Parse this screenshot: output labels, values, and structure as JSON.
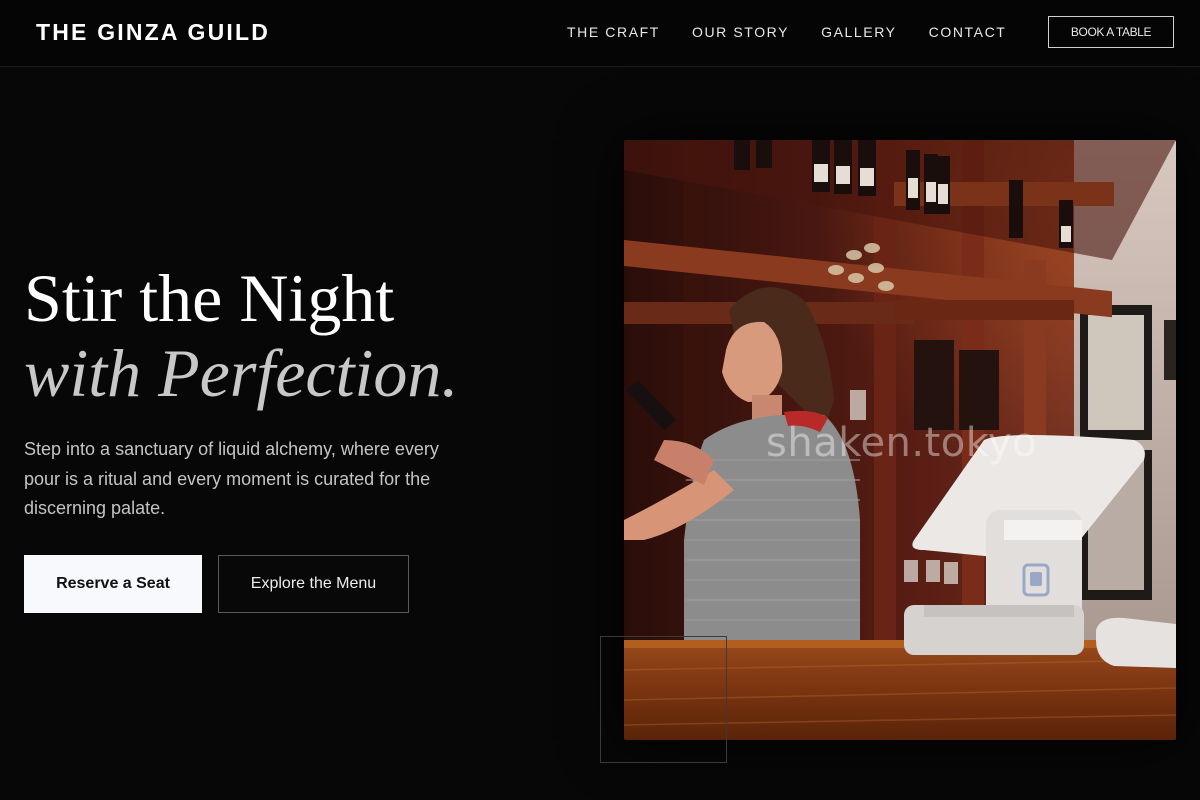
{
  "header": {
    "brand": "THE GINZA GUILD",
    "nav": [
      "THE CRAFT",
      "OUR STORY",
      "GALLERY",
      "CONTACT"
    ],
    "cta": "BOOK A TABLE"
  },
  "hero": {
    "headline_line1": "Stir the Night",
    "headline_line2": "with Perfection.",
    "subtext": "Step into a sanctuary of liquid alchemy, where every pour is a ritual and every moment is curated for the discerning palate.",
    "primary_button": "Reserve a Seat",
    "secondary_button": "Explore the Menu"
  },
  "image": {
    "watermark": "shaken.tokyo"
  },
  "colors": {
    "background": "#070707",
    "text": "#ffffff",
    "accent_muted": "#c8c8c8",
    "primary_button_bg": "#f8f9fc"
  }
}
